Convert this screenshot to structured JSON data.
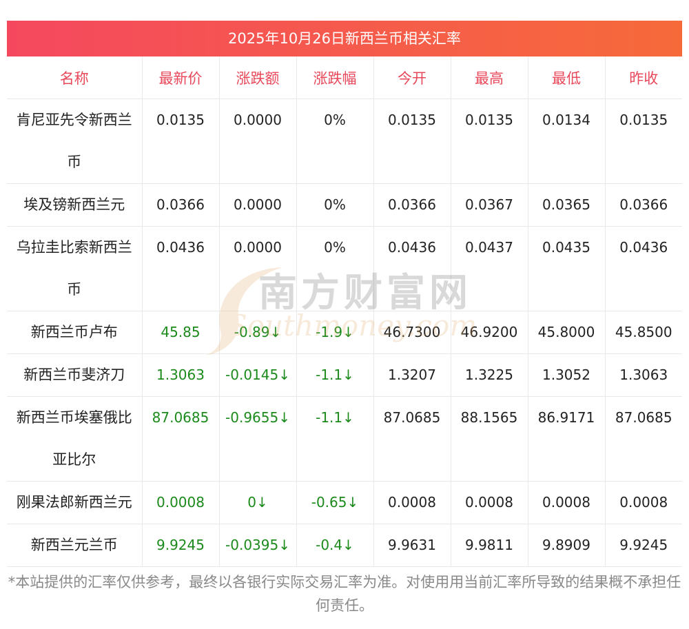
{
  "title": "2025年10月26日新西兰币相关汇率",
  "columns": [
    "名称",
    "最新价",
    "涨跌额",
    "涨跌幅",
    "今开",
    "最高",
    "最低",
    "昨收"
  ],
  "rows": [
    {
      "name": "肯尼亚先令新西兰币",
      "latest": "0.0135",
      "change": "0.0000",
      "pct": "0%",
      "open": "0.0135",
      "high": "0.0135",
      "low": "0.0134",
      "prev": "0.0135",
      "up": false,
      "tall": true
    },
    {
      "name": "埃及镑新西兰元",
      "latest": "0.0366",
      "change": "0.0000",
      "pct": "0%",
      "open": "0.0366",
      "high": "0.0367",
      "low": "0.0365",
      "prev": "0.0366",
      "up": false,
      "tall": false
    },
    {
      "name": "乌拉圭比索新西兰币",
      "latest": "0.0436",
      "change": "0.0000",
      "pct": "0%",
      "open": "0.0436",
      "high": "0.0437",
      "low": "0.0435",
      "prev": "0.0436",
      "up": false,
      "tall": true
    },
    {
      "name": "新西兰币卢布",
      "latest": "45.85",
      "change": "-0.89↓",
      "pct": "-1.9↓",
      "open": "46.7300",
      "high": "46.9200",
      "low": "45.8000",
      "prev": "45.8500",
      "up": true,
      "tall": false
    },
    {
      "name": "新西兰币斐济刀",
      "latest": "1.3063",
      "change": "-0.0145↓",
      "pct": "-1.1↓",
      "open": "1.3207",
      "high": "1.3225",
      "low": "1.3052",
      "prev": "1.3063",
      "up": true,
      "tall": false
    },
    {
      "name": "新西兰币埃塞俄比亚比尔",
      "latest": "87.0685",
      "change": "-0.9655↓",
      "pct": "-1.1↓",
      "open": "87.0685",
      "high": "88.1565",
      "low": "86.9171",
      "prev": "87.0685",
      "up": true,
      "tall": true
    },
    {
      "name": "刚果法郎新西兰元",
      "latest": "0.0008",
      "change": "0↓",
      "pct": "-0.65↓",
      "open": "0.0008",
      "high": "0.0008",
      "low": "0.0008",
      "prev": "0.0008",
      "up": true,
      "tall": false
    },
    {
      "name": "新西兰元兰币",
      "latest": "9.9245",
      "change": "-0.0395↓",
      "pct": "-0.4↓",
      "open": "9.9631",
      "high": "9.9811",
      "low": "9.8909",
      "prev": "9.9245",
      "up": true,
      "tall": false
    }
  ],
  "footer": "*本站提供的汇率仅供参考，最终以各银行实际交易汇率为准。对使用用当前汇率所导致的结果概不承担任何责任。",
  "watermark": {
    "cn": "南方财富网",
    "en": "Southmoney.com"
  },
  "colors": {
    "header_text": "#e8485a",
    "up_text": "#1b8a1b",
    "title_bar_start": "#f5485f",
    "title_bar_end": "#f66a3a"
  }
}
